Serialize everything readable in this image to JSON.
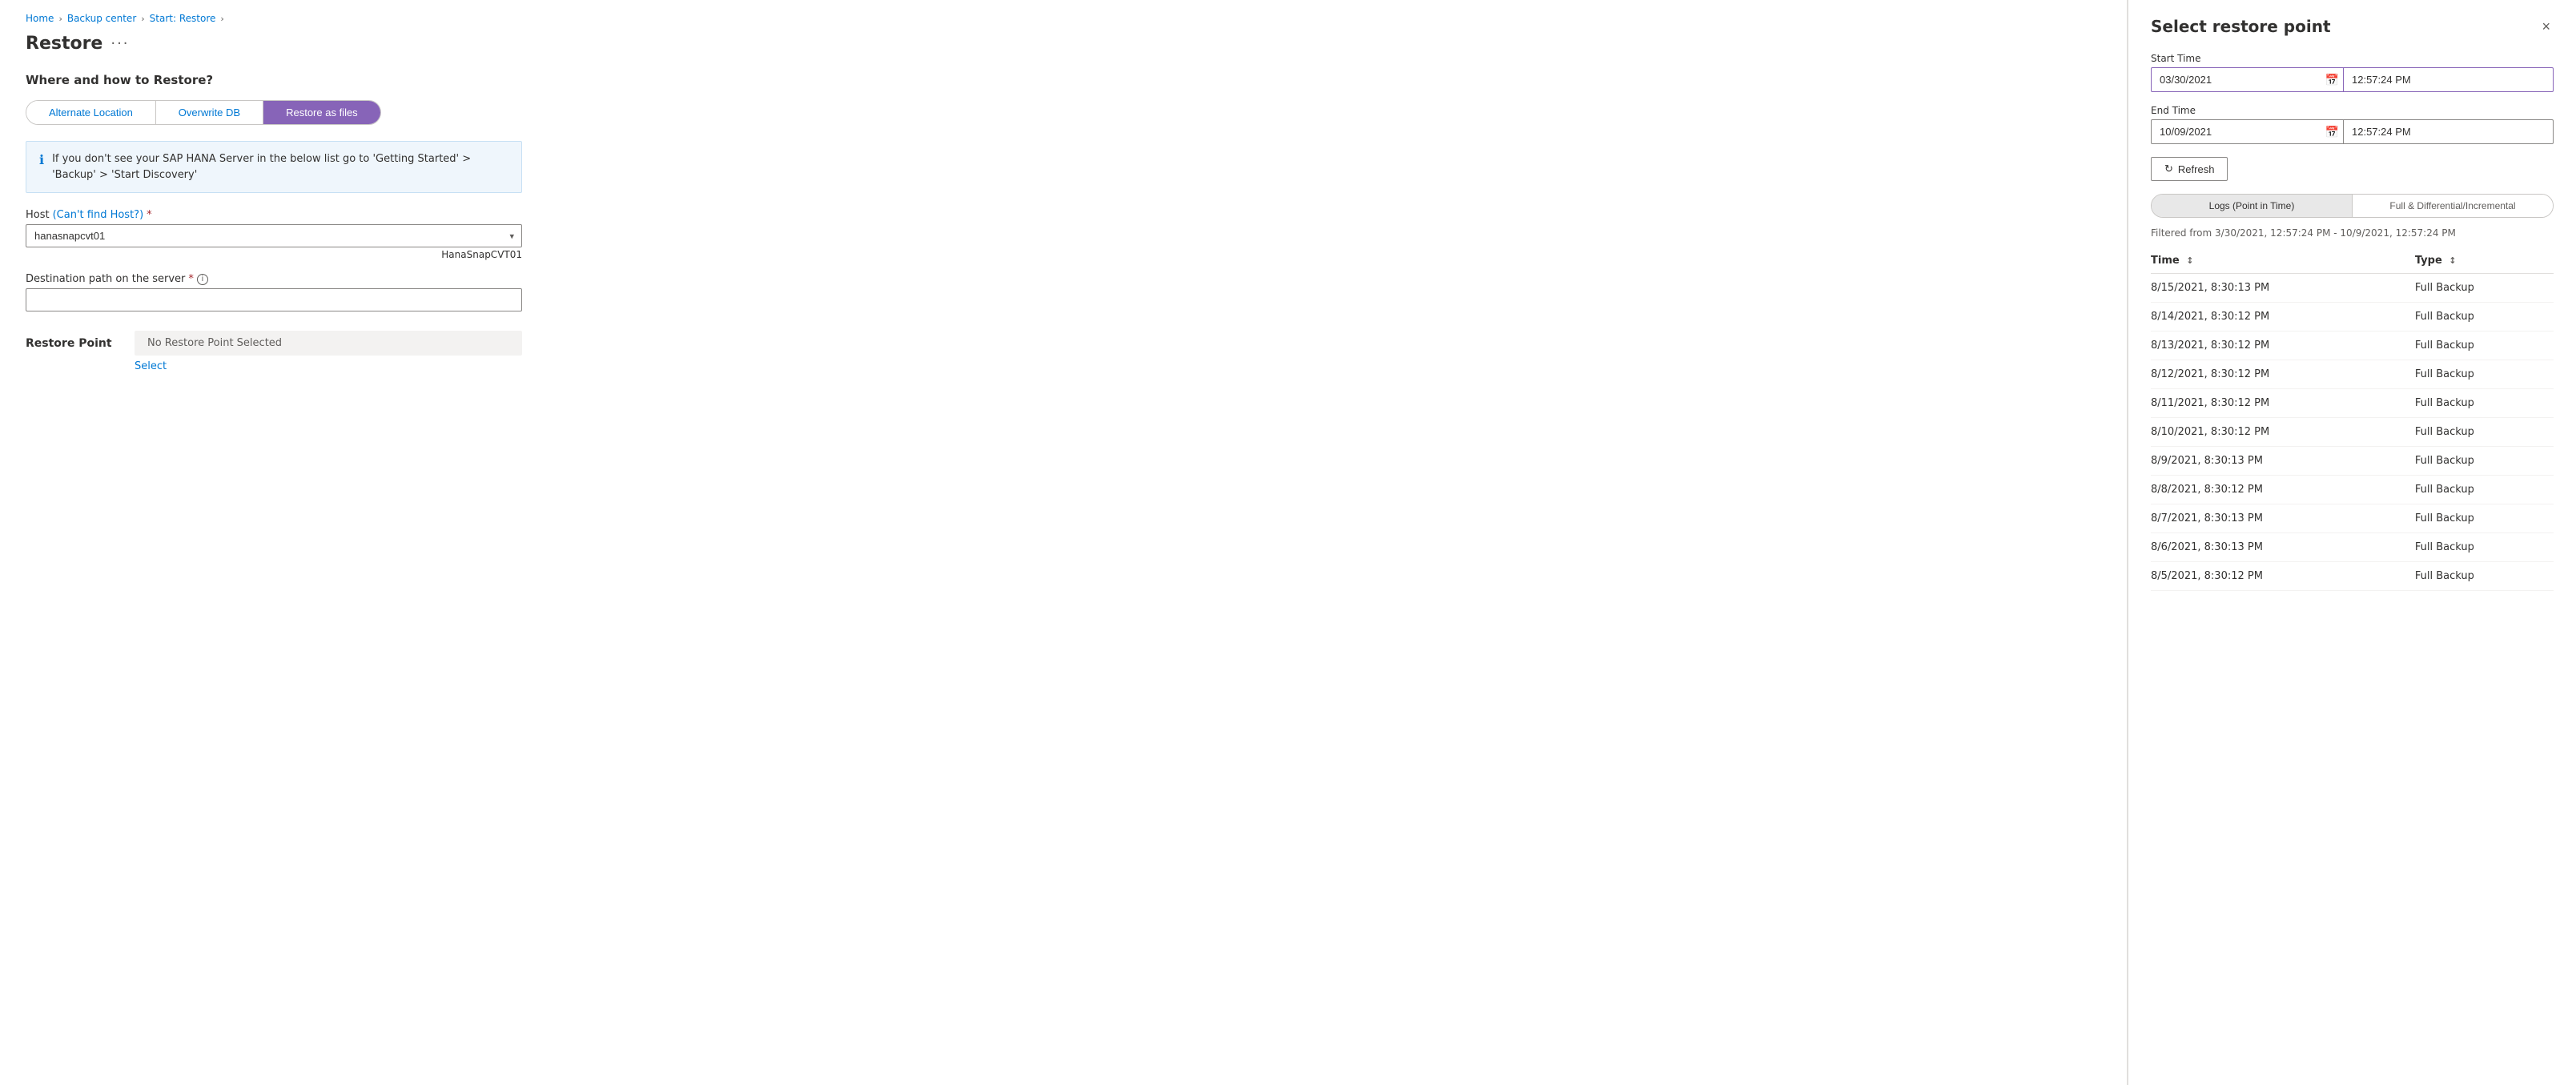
{
  "breadcrumb": {
    "home": "Home",
    "backup_center": "Backup center",
    "start_restore": "Start: Restore",
    "current": "Restore"
  },
  "page": {
    "title": "Restore",
    "more_options": "···"
  },
  "form": {
    "section_heading": "Where and how to Restore?",
    "tabs": [
      {
        "id": "alternate",
        "label": "Alternate Location",
        "active": false
      },
      {
        "id": "overwrite",
        "label": "Overwrite DB",
        "active": false
      },
      {
        "id": "restore_files",
        "label": "Restore as files",
        "active": true
      }
    ],
    "info_message": "If you don't see your SAP HANA Server in the below list go to 'Getting Started' > 'Backup' > 'Start Discovery'",
    "host_label": "Host",
    "host_link_text": "(Can't find Host?)",
    "host_placeholder": "hanasnapcvt01",
    "host_value": "hanasnapcvt01",
    "host_hint": "HanaSnapCVT01",
    "destination_label": "Destination path on the server",
    "destination_placeholder": "",
    "destination_value": "",
    "restore_point_label": "Restore Point",
    "restore_point_value": "No Restore Point Selected",
    "select_link": "Select"
  },
  "right_panel": {
    "title": "Select restore point",
    "close_label": "×",
    "start_time_label": "Start Time",
    "start_date_value": "03/30/2021",
    "start_time_value": "12:57:24 PM",
    "end_time_label": "End Time",
    "end_date_value": "10/09/2021",
    "end_time_value": "12:57:24 PM",
    "refresh_label": "Refresh",
    "toggle_tabs": [
      {
        "id": "logs",
        "label": "Logs (Point in Time)",
        "active": true
      },
      {
        "id": "full_diff",
        "label": "Full & Differential/Incremental",
        "active": false
      }
    ],
    "filter_text": "Filtered from 3/30/2021, 12:57:24 PM - 10/9/2021, 12:57:24 PM",
    "table_headers": [
      {
        "label": "Time",
        "sortable": true
      },
      {
        "label": "Type",
        "sortable": true
      }
    ],
    "table_rows": [
      {
        "time": "8/15/2021, 8:30:13 PM",
        "type": "Full Backup"
      },
      {
        "time": "8/14/2021, 8:30:12 PM",
        "type": "Full Backup"
      },
      {
        "time": "8/13/2021, 8:30:12 PM",
        "type": "Full Backup"
      },
      {
        "time": "8/12/2021, 8:30:12 PM",
        "type": "Full Backup"
      },
      {
        "time": "8/11/2021, 8:30:12 PM",
        "type": "Full Backup"
      },
      {
        "time": "8/10/2021, 8:30:12 PM",
        "type": "Full Backup"
      },
      {
        "time": "8/9/2021, 8:30:13 PM",
        "type": "Full Backup"
      },
      {
        "time": "8/8/2021, 8:30:12 PM",
        "type": "Full Backup"
      },
      {
        "time": "8/7/2021, 8:30:13 PM",
        "type": "Full Backup"
      },
      {
        "time": "8/6/2021, 8:30:13 PM",
        "type": "Full Backup"
      },
      {
        "time": "8/5/2021, 8:30:12 PM",
        "type": "Full Backup"
      }
    ]
  }
}
